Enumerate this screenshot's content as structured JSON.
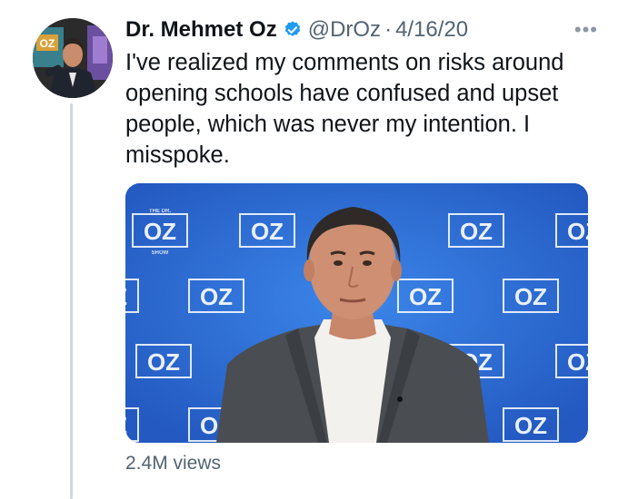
{
  "tweet": {
    "display_name": "Dr. Mehmet Oz",
    "verified": true,
    "handle": "@DrOz",
    "separator": "·",
    "date": "4/16/20",
    "more_icon": "more-horizontal-icon",
    "text": "I've realized my comments on risks around opening schools have confused and upset people, which was never my intention. I misspoke.",
    "views": "2.4M views"
  },
  "avatar": {
    "logo_text": "OZ"
  },
  "media": {
    "backdrop_logo": "OZ",
    "backdrop_small_top": "THE DR.",
    "backdrop_small_bottom": "SHOW"
  },
  "colors": {
    "verified_blue": "#1d9bf0",
    "backdrop_blue": "#2a6fd6",
    "thread_line": "#cfd9de",
    "secondary_text": "#536471"
  }
}
